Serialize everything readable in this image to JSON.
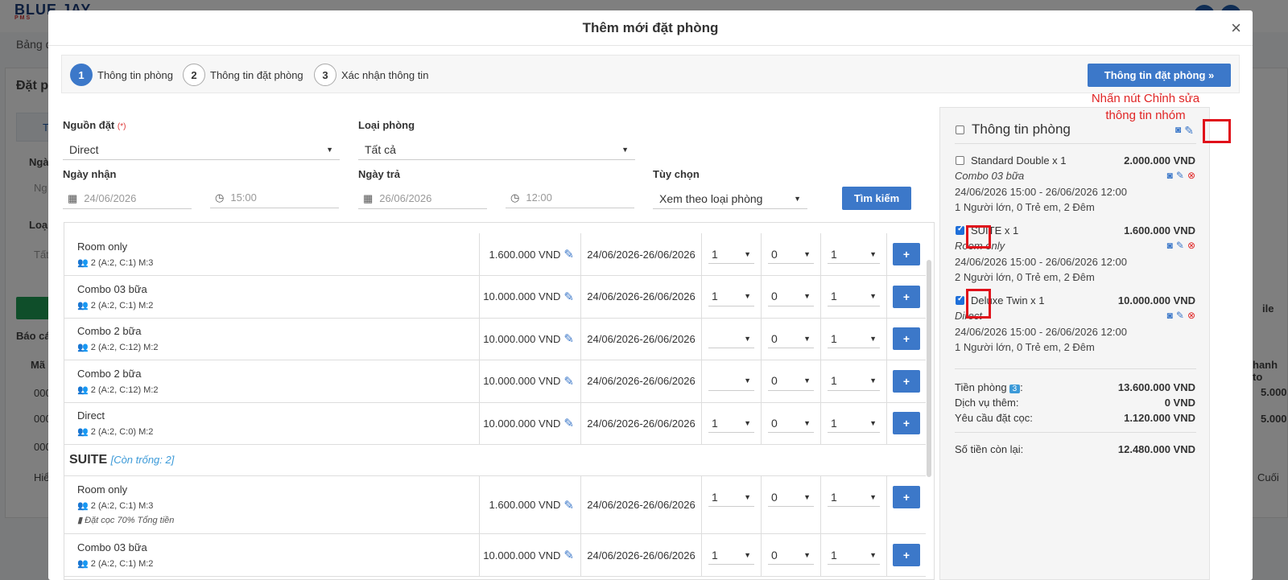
{
  "background": {
    "logo": "BLUE JAY",
    "logo_sub": "PMS",
    "menu_label": "Bảng đ",
    "page_title": "Đặt p",
    "filter_label": "T",
    "form_label_1": "Ngà",
    "form_value_1": "Ng",
    "form_label_2": "Loại",
    "form_value_2": "Tất",
    "report_label": "Báo cá",
    "col_label": "Mã",
    "rows": [
      "000",
      "000",
      "000"
    ],
    "pager_label": "Hiể",
    "right_label": "ile",
    "right_col": "hanh to",
    "right_val_1": "5.000",
    "right_val_2": "5.000",
    "right_pager": "Cuối"
  },
  "modal": {
    "title": "Thêm mới đặt phòng",
    "close": "×"
  },
  "steps": [
    {
      "num": "1",
      "label": "Thông tin phòng"
    },
    {
      "num": "2",
      "label": "Thông tin đặt phòng"
    },
    {
      "num": "3",
      "label": "Xác nhận thông tin"
    }
  ],
  "next_button": "Thông tin đặt phòng »",
  "form": {
    "source_label": "Nguồn đặt",
    "required_mark": "(*)",
    "source_value": "Direct",
    "room_type_label": "Loại phòng",
    "room_type_value": "Tất cả",
    "checkin_label": "Ngày nhận",
    "checkin_date": "24/06/2026",
    "checkin_time": "15:00",
    "checkout_label": "Ngày trả",
    "checkout_date": "26/06/2026",
    "checkout_time": "12:00",
    "option_label": "Tùy chọn",
    "option_value": "Xem theo loại phòng",
    "search_button": "Tìm kiếm"
  },
  "rows": [
    {
      "name": "Room only",
      "info": "2 (A:2, C:1) M:3",
      "note": "",
      "price": "1.600.000 VND",
      "date": "24/06/2026-26/06/2026",
      "s1": "1",
      "s2": "0",
      "s3": "1"
    },
    {
      "name": "Combo 03 bữa",
      "info": "2 (A:2, C:1) M:2",
      "note": "",
      "price": "10.000.000 VND",
      "date": "24/06/2026-26/06/2026",
      "s1": "1",
      "s2": "0",
      "s3": "1"
    },
    {
      "name": "Combo 2 bữa",
      "info": "2 (A:2, C:12) M:2",
      "note": "",
      "price": "10.000.000 VND",
      "date": "24/06/2026-26/06/2026",
      "s1": "",
      "s2": "0",
      "s3": "1"
    },
    {
      "name": "Combo 2 bữa",
      "info": "2 (A:2, C:12) M:2",
      "note": "",
      "price": "10.000.000 VND",
      "date": "24/06/2026-26/06/2026",
      "s1": "",
      "s2": "0",
      "s3": "1"
    },
    {
      "name": "Direct",
      "info": "2 (A:2, C:0) M:2",
      "note": "",
      "price": "10.000.000 VND",
      "date": "24/06/2026-26/06/2026",
      "s1": "1",
      "s2": "0",
      "s3": "1"
    }
  ],
  "group": {
    "name": "SUITE",
    "availability": "[Còn trống: 2]"
  },
  "group_rows": [
    {
      "name": "Room only",
      "info": "2 (A:2, C:1) M:3",
      "note": "Đặt cọc 70% Tổng tiền",
      "price": "1.600.000 VND",
      "date": "24/06/2026-26/06/2026",
      "s1": "1",
      "s2": "0",
      "s3": "1"
    },
    {
      "name": "Combo 03 bữa",
      "info": "2 (A:2, C:1) M:2",
      "note": "",
      "price": "10.000.000 VND",
      "date": "24/06/2026-26/06/2026",
      "s1": "1",
      "s2": "0",
      "s3": "1"
    }
  ],
  "add_button": "+",
  "panel": {
    "title": "Thông tin phòng",
    "items": [
      {
        "name": "Standard Double x 1",
        "price": "2.000.000 VND",
        "plan": "Combo 03 bữa",
        "dates": "24/06/2026 15:00 - 26/06/2026 12:00",
        "guests": "1 Người lớn, 0 Trẻ em, 2 Đêm",
        "checked": false
      },
      {
        "name": "SUITE x 1",
        "price": "1.600.000 VND",
        "plan": "Room only",
        "dates": "24/06/2026 15:00 - 26/06/2026 12:00",
        "guests": "2 Người lớn, 0 Trẻ em, 2 Đêm",
        "checked": true
      },
      {
        "name": "Deluxe Twin x 1",
        "price": "10.000.000 VND",
        "plan": "Direct",
        "dates": "24/06/2026 15:00 - 26/06/2026 12:00",
        "guests": "1 Người lớn, 0 Trẻ em, 2 Đêm",
        "checked": true
      }
    ],
    "room_total_label": "Tiền phòng",
    "room_count": "3",
    "room_total_colon": ":",
    "room_total": "13.600.000 VND",
    "service_label": "Dịch vụ thêm:",
    "service_total": "0 VND",
    "deposit_label": "Yêu cầu đặt cọc:",
    "deposit_total": "1.120.000 VND",
    "remaining_label": "Số tiền còn lại:",
    "remaining_total": "12.480.000 VND"
  },
  "annotation": {
    "line1": "Nhấn nút Chỉnh sửa",
    "line2": "thông tin nhóm"
  },
  "colors": {
    "primary": "#3c78c9",
    "annotation": "#e02424"
  }
}
